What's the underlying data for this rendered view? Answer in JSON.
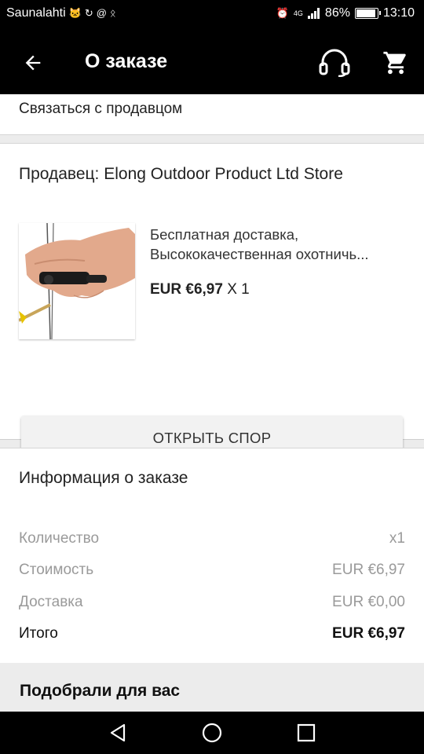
{
  "status": {
    "carrier": "Saunalahti",
    "battery": "86%",
    "battery_level": 0.86,
    "time": "13:10",
    "network": "4G",
    "icons_left": [
      "cat-notification-icon",
      "sync-icon",
      "at-icon",
      "ok-icon"
    ],
    "icons_right": [
      "alarm-icon",
      "signal-icon",
      "battery-icon"
    ]
  },
  "appbar": {
    "title": "О заказе",
    "back_icon": "arrow-left-icon",
    "support_icon": "headset-icon",
    "cart_icon": "cart-icon"
  },
  "contact": {
    "label": "Связаться с продавцом"
  },
  "seller": {
    "name": "Продавец: Elong Outdoor Product Ltd Store"
  },
  "product": {
    "desc_line1": "Бесплатная доставка,",
    "desc_line2": "Высококачественная охотничь...",
    "price": "EUR €6,97",
    "qty": "X 1"
  },
  "dispute": {
    "label": "ОТКРЫТЬ СПОР"
  },
  "order_info": {
    "title": "Информация о заказе",
    "rows": [
      {
        "label": "Количество",
        "value": "x1"
      },
      {
        "label": "Стоимость",
        "value": "EUR €6,97"
      },
      {
        "label": "Доставка",
        "value": "EUR €0,00"
      }
    ],
    "total": {
      "label": "Итого",
      "value": "EUR €6,97"
    }
  },
  "recommendations": {
    "title": "Подобрали для вас"
  },
  "navbar": {
    "icons": [
      "nav-back-icon",
      "nav-home-icon",
      "nav-recents-icon"
    ]
  },
  "colors": {
    "appbar": "#000000",
    "background": "#ececec",
    "muted_text": "#9a9a9a",
    "button": "#f2f2f2"
  }
}
